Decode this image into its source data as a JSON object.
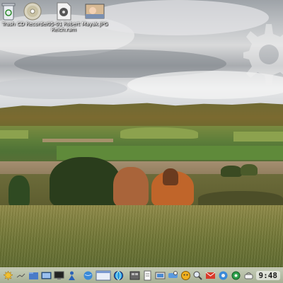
{
  "desktop": {
    "icons": [
      {
        "name": "trash-icon",
        "label": "Trash"
      },
      {
        "name": "cd-recorder-icon",
        "label": "CD Recorder"
      },
      {
        "name": "music-file-icon",
        "label": "05-01 Robert Reich.ram"
      },
      {
        "name": "image-file-icon",
        "label": "Mayak.JPG"
      }
    ]
  },
  "taskbar": {
    "clock": "9:48",
    "launchers": [
      "start-menu-icon",
      "file-manager-icon",
      "terminal-icon",
      "browser-icon",
      "monitor-icon",
      "user-icon",
      "network-icon",
      "desktop-switch-icon",
      "web-icon",
      "window-1-icon",
      "window-2-icon",
      "editor-icon",
      "messenger-icon",
      "chat-icon",
      "search-icon",
      "mail-icon",
      "tray-globe-icon",
      "tray-cog-icon",
      "tray-network-icon"
    ]
  }
}
